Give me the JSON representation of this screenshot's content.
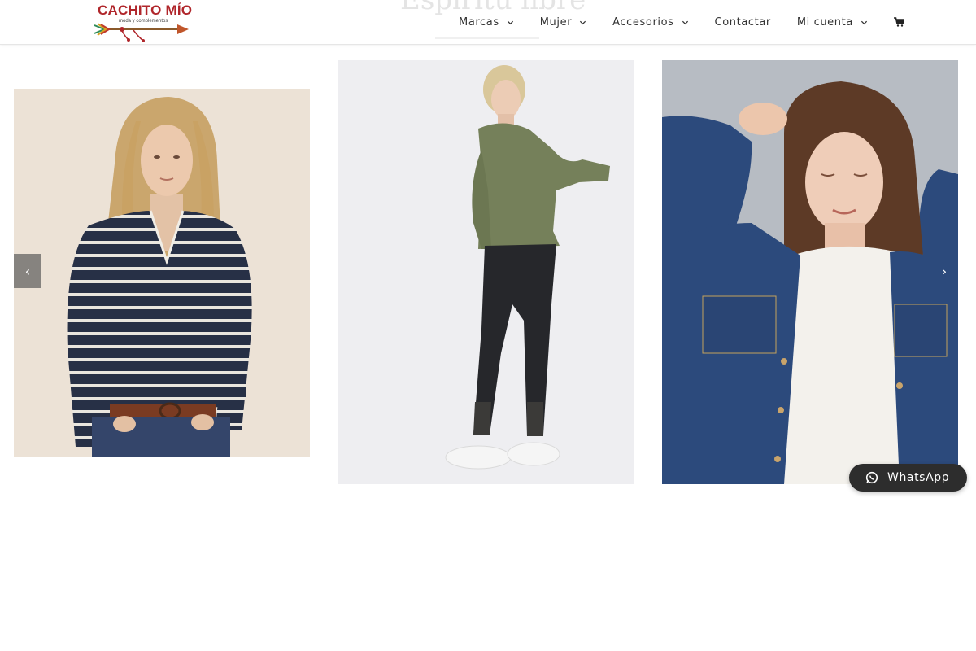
{
  "brand": {
    "name": "CACHITO MÍO",
    "tagline": "moda y complementos",
    "primary_color": "#b0262b"
  },
  "section": {
    "title": "Espíritu libre"
  },
  "nav": {
    "items": [
      {
        "label": "Marcas",
        "has_dropdown": true
      },
      {
        "label": "Mujer",
        "has_dropdown": true
      },
      {
        "label": "Accesorios",
        "has_dropdown": true
      },
      {
        "label": "Contactar",
        "has_dropdown": false
      },
      {
        "label": "Mi cuenta",
        "has_dropdown": true
      }
    ],
    "cart_icon": "shopping-cart-icon"
  },
  "slider": {
    "prev_icon": "chevron-left-icon",
    "next_icon": "chevron-right-icon",
    "prev_glyph": "‹",
    "next_glyph": "›",
    "slides": [
      {
        "subject": "striped-sweater-photo"
      },
      {
        "subject": "green-sweater-jeans-photo"
      },
      {
        "subject": "denim-shirt-photo"
      }
    ]
  },
  "whatsapp": {
    "label": "WhatsApp",
    "icon": "whatsapp-icon",
    "background": "#2d2d2d"
  }
}
